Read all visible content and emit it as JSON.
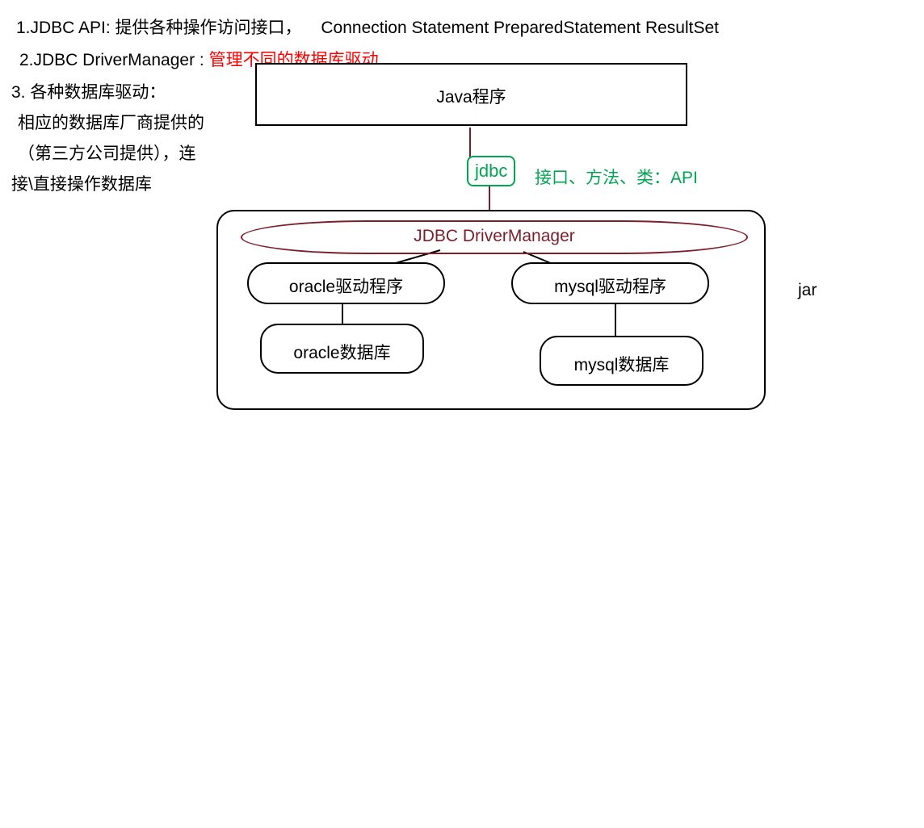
{
  "lines": {
    "l1a": "1.JDBC API: 提供各种操作访问接口，",
    "l1b": "Connection   Statement   PreparedStatement  ResultSet",
    "l2a": "2.JDBC DriverManager :",
    "l2b": "管理不同的数据库驱动",
    "l3a": "3. 各种数据库驱动：",
    "l3b": "相应的数据库厂商提供的",
    "l3c": "（第三方公司提供），连",
    "l3d": "接\\直接操作数据库"
  },
  "boxes": {
    "java": "Java程序",
    "jdbc": "jdbc",
    "api": "接口、方法、类：API",
    "dm": "JDBC DriverManager",
    "oracleDriver": "oracle驱动程序",
    "mysqlDriver": "mysql驱动程序",
    "oracleDb": "oracle数据库",
    "mysqlDb": "mysql数据库",
    "jar": "jar"
  }
}
